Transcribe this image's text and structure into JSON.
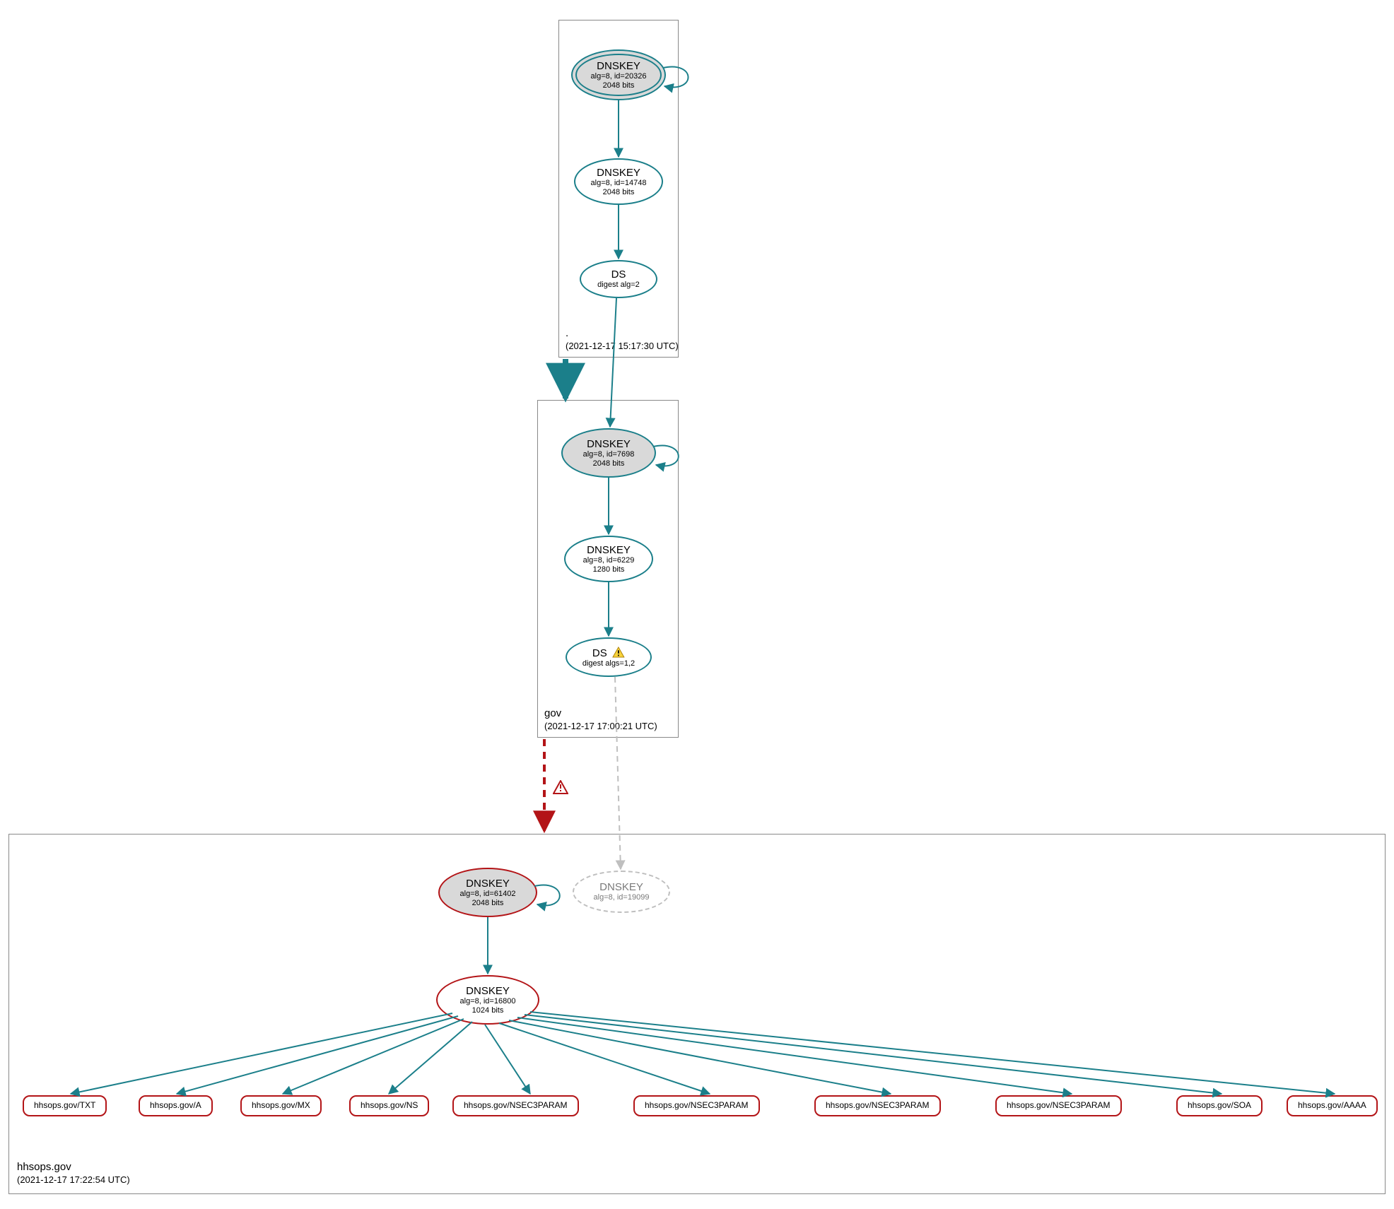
{
  "colors": {
    "teal": "#1b7f8a",
    "red": "#b31417",
    "gray_fill": "#d9d9d9",
    "dashed_gray": "#bfbfbf"
  },
  "zones": {
    "root": {
      "name": ".",
      "timestamp": "(2021-12-17 15:17:30 UTC)"
    },
    "gov": {
      "name": "gov",
      "timestamp": "(2021-12-17 17:00:21 UTC)"
    },
    "hhsops": {
      "name": "hhsops.gov",
      "timestamp": "(2021-12-17 17:22:54 UTC)"
    }
  },
  "nodes": {
    "root_ksk": {
      "title": "DNSKEY",
      "line2": "alg=8, id=20326",
      "line3": "2048 bits"
    },
    "root_zsk": {
      "title": "DNSKEY",
      "line2": "alg=8, id=14748",
      "line3": "2048 bits"
    },
    "root_ds": {
      "title": "DS",
      "line2": "digest alg=2"
    },
    "gov_ksk": {
      "title": "DNSKEY",
      "line2": "alg=8, id=7698",
      "line3": "2048 bits"
    },
    "gov_zsk": {
      "title": "DNSKEY",
      "line2": "alg=8, id=6229",
      "line3": "1280 bits"
    },
    "gov_ds": {
      "title": "DS",
      "line2": "digest algs=1,2"
    },
    "hhs_ksk": {
      "title": "DNSKEY",
      "line2": "alg=8, id=61402",
      "line3": "2048 bits"
    },
    "hhs_ghost": {
      "title": "DNSKEY",
      "line2": "alg=8, id=19099"
    },
    "hhs_zsk": {
      "title": "DNSKEY",
      "line2": "alg=8, id=16800",
      "line3": "1024 bits"
    }
  },
  "rrsets": [
    "hhsops.gov/TXT",
    "hhsops.gov/A",
    "hhsops.gov/MX",
    "hhsops.gov/NS",
    "hhsops.gov/NSEC3PARAM",
    "hhsops.gov/NSEC3PARAM",
    "hhsops.gov/NSEC3PARAM",
    "hhsops.gov/NSEC3PARAM",
    "hhsops.gov/SOA",
    "hhsops.gov/AAAA"
  ],
  "icons": {
    "warning": "warning-icon",
    "error_triangle": "error-icon"
  }
}
